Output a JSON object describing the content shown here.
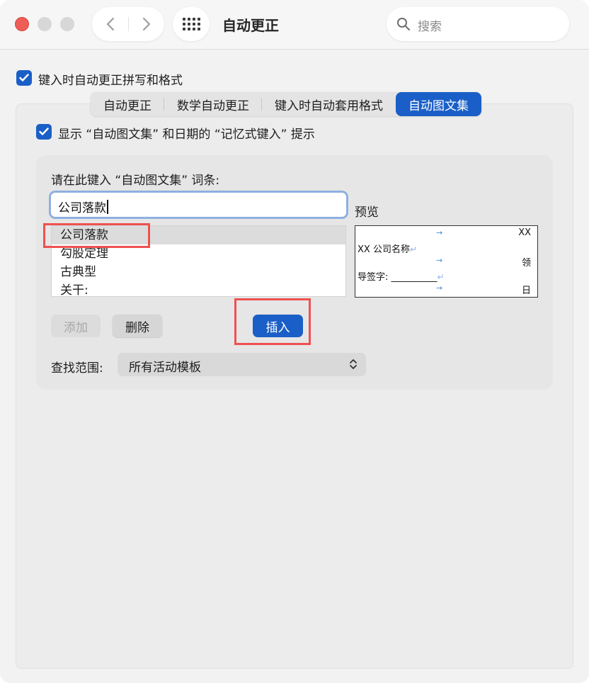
{
  "window": {
    "title": "自动更正",
    "search_placeholder": "搜索"
  },
  "main_checkbox": {
    "label": "键入时自动更正拼写和格式",
    "checked": true
  },
  "tabs": [
    {
      "label": "自动更正",
      "active": false
    },
    {
      "label": "数学自动更正",
      "active": false
    },
    {
      "label": "键入时自动套用格式",
      "active": false
    },
    {
      "label": "自动图文集",
      "active": true
    }
  ],
  "autotext": {
    "show_checkbox_label": "显示 “自动图文集” 和日期的 “记忆式键入” 提示",
    "show_checked": true,
    "entry_prompt": "请在此键入 “自动图文集” 词条:",
    "entry_value": "公司落款",
    "preview_label": "预览",
    "items": [
      "公司落款",
      "勾股定理",
      "古典型",
      "关干:"
    ],
    "selected_index": 0,
    "preview": {
      "line1_right": "XX",
      "line2": "XX 公司名称",
      "line3_right": "领",
      "line4": "导签字: __________",
      "line5_right": "日"
    },
    "buttons": {
      "add": "添加",
      "delete": "删除",
      "insert": "插入"
    },
    "search_scope_label": "查找范围:",
    "search_scope_value": "所有活动模板"
  },
  "colors": {
    "accent": "#1a5fc7",
    "highlight_box": "#ef5150"
  }
}
